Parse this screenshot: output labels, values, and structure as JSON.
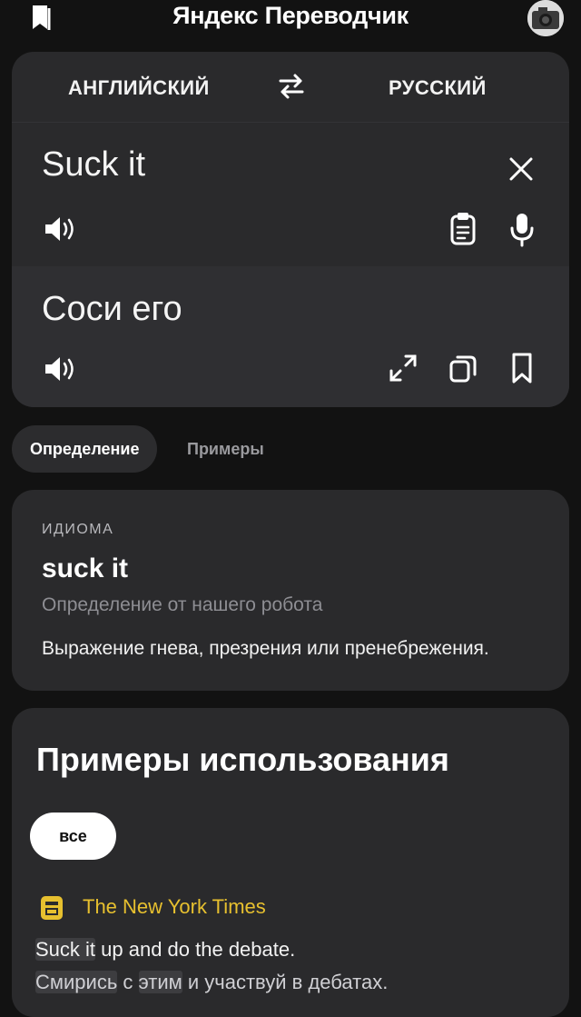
{
  "header": {
    "title": "Яндекс Переводчик",
    "icons": {
      "left": "bookmark-collection-icon",
      "right": "avatar"
    }
  },
  "translator": {
    "source_lang": "АНГЛИЙСКИЙ",
    "target_lang": "РУССКИЙ",
    "source_text": "Suck it",
    "target_text": "Соси его",
    "source_icons": [
      "speaker-icon",
      "paste-icon",
      "microphone-icon",
      "close-icon"
    ],
    "target_icons": [
      "speaker-icon",
      "fullscreen-icon",
      "copy-icon",
      "bookmark-icon"
    ]
  },
  "tabs": [
    {
      "label": "Определение",
      "active": true
    },
    {
      "label": "Примеры",
      "active": false
    }
  ],
  "definition": {
    "label": "ИДИОМА",
    "term": "suck it",
    "source": "Определение от нашего робота",
    "text": "Выражение гнева, презрения или пренебрежения."
  },
  "examples": {
    "title": "Примеры использования",
    "filter_chip": "все",
    "source_name": "The New York Times",
    "en": {
      "highlight": "Suck it",
      "rest": " up and do the debate."
    },
    "ru": {
      "hl1": "Смирись",
      "mid1": " с ",
      "hl2": "этим",
      "rest": " и участвуй в дебатах."
    }
  },
  "colors": {
    "background": "#121212",
    "card": "#2a2a2c",
    "accent_source": "#e7c02f",
    "muted": "#8e8e93"
  }
}
